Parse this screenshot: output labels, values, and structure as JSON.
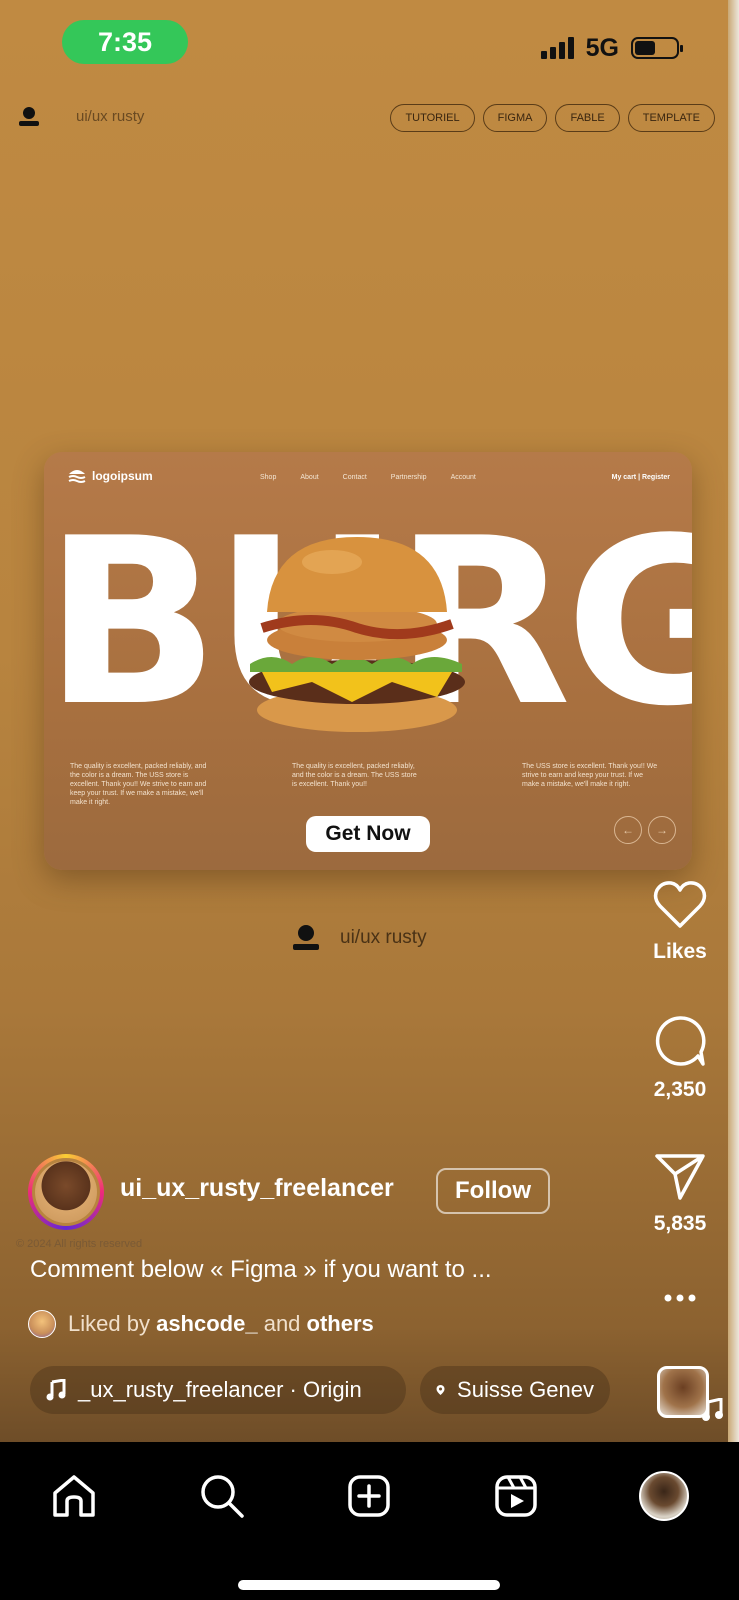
{
  "status_bar": {
    "time": "7:35",
    "network": "5G"
  },
  "video_header": {
    "user_text": "ui/ux rusty",
    "chips": [
      "TUTORIEL",
      "FIGMA",
      "FABLE",
      "TEMPLATE"
    ]
  },
  "design_card": {
    "logo": "logoipsum",
    "nav": [
      "Shop",
      "About",
      "Contact",
      "Partnership",
      "Account"
    ],
    "cart": "My cart | Register",
    "big_word": "BURGER",
    "paragraphs": [
      "The quality is excellent, packed reliably, and the color is a dream. The USS store is excellent. Thank you!! We strive to earn and keep your trust. If we make a mistake, we'll make it right.",
      "The quality is excellent, packed reliably, and the color is a dream. The USS store is excellent. Thank you!!",
      "The USS store is excellent. Thank you!! We strive to earn and keep your trust. If we make a mistake, we'll make it right."
    ],
    "cta": "Get Now",
    "prev_arrow": "←",
    "next_arrow": "→"
  },
  "watermark": "ui/ux rusty",
  "actions": {
    "likes_label": "Likes",
    "comments_count": "2,350",
    "shares_count": "5,835"
  },
  "post": {
    "username": "ui_ux_rusty_freelancer",
    "follow_label": "Follow",
    "copyright": "© 2024 All rights reserved",
    "caption": "Comment below « Figma » if you want to ...",
    "liked_prefix": "Liked by",
    "liked_user": "ashcode_",
    "liked_and": "and",
    "liked_others": "others",
    "audio": "_ux_rusty_freelancer · Origin",
    "location": "Suisse Genev"
  },
  "icons": {
    "home": "home-icon",
    "search": "search-icon",
    "create": "create-icon",
    "reels": "reels-icon",
    "profile": "profile-icon"
  },
  "colors": {
    "background": "#b8843f",
    "status_time_bg": "#34c759",
    "tabbar": "#000000"
  }
}
